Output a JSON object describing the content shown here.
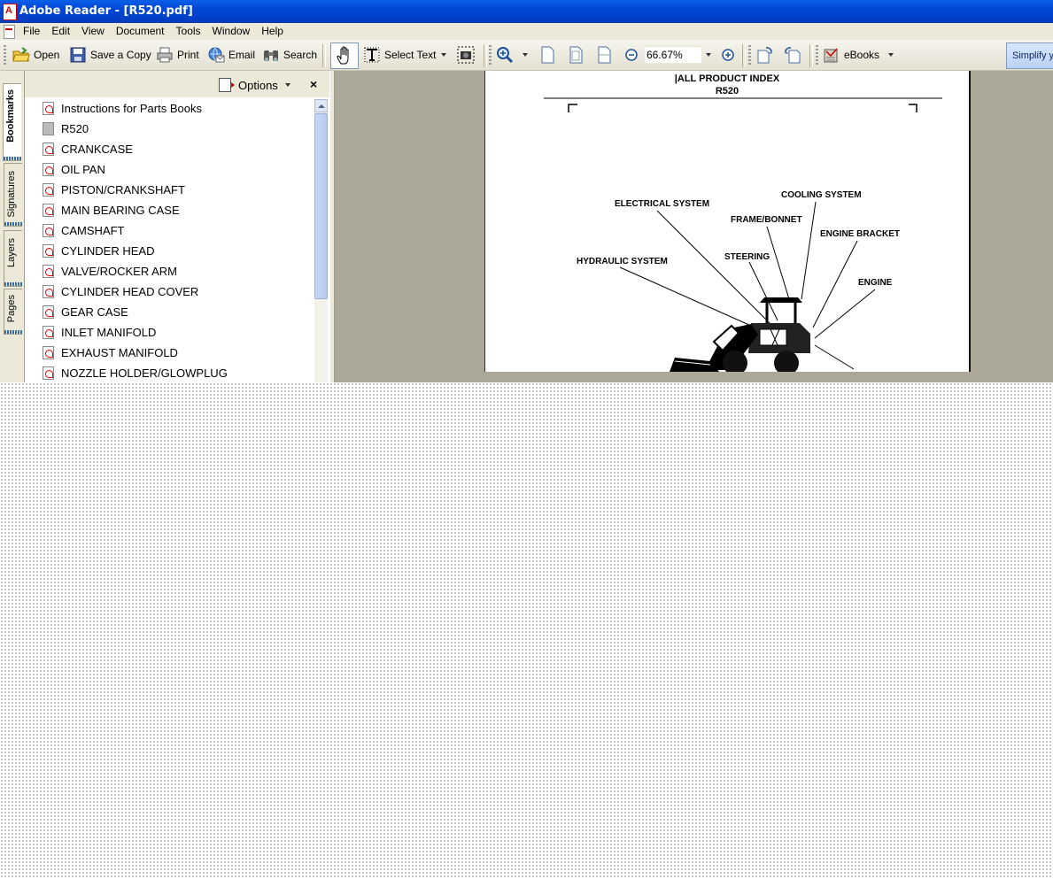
{
  "window": {
    "title": "Adobe Reader - [R520.pdf]"
  },
  "menu": [
    "File",
    "Edit",
    "View",
    "Document",
    "Tools",
    "Window",
    "Help"
  ],
  "toolbar": {
    "open": "Open",
    "save_copy": "Save a Copy",
    "print": "Print",
    "email": "Email",
    "search": "Search",
    "select_text": "Select Text",
    "zoom_value": "66.67%",
    "ebooks": "eBooks",
    "simplify": "Simplify y"
  },
  "nav_tabs": [
    "Bookmarks",
    "Signatures",
    "Layers",
    "Pages"
  ],
  "panel": {
    "options": "Options",
    "close": "×"
  },
  "bookmarks": [
    {
      "label": "Instructions for Parts Books",
      "icon": "pdf-page-icon"
    },
    {
      "label": "R520",
      "icon": "gray-page-icon"
    },
    {
      "label": "CRANKCASE",
      "icon": "pdf-page-icon"
    },
    {
      "label": "OIL PAN",
      "icon": "pdf-page-icon"
    },
    {
      "label": "PISTON/CRANKSHAFT",
      "icon": "pdf-page-icon"
    },
    {
      "label": "MAIN BEARING CASE",
      "icon": "pdf-page-icon"
    },
    {
      "label": "CAMSHAFT",
      "icon": "pdf-page-icon"
    },
    {
      "label": "CYLINDER HEAD",
      "icon": "pdf-page-icon"
    },
    {
      "label": "VALVE/ROCKER ARM",
      "icon": "pdf-page-icon"
    },
    {
      "label": "CYLINDER HEAD COVER",
      "icon": "pdf-page-icon"
    },
    {
      "label": "GEAR CASE",
      "icon": "pdf-page-icon"
    },
    {
      "label": "INLET MANIFOLD",
      "icon": "pdf-page-icon"
    },
    {
      "label": "EXHAUST MANIFOLD",
      "icon": "pdf-page-icon"
    },
    {
      "label": "NOZZLE HOLDER/GLOWPLUG",
      "icon": "pdf-page-icon"
    }
  ],
  "document": {
    "heading": "|ALL PRODUCT INDEX",
    "model": "R520",
    "labels": {
      "electrical": "ELECTRICAL SYSTEM",
      "cooling": "COOLING SYSTEM",
      "frame": "FRAME/BONNET",
      "engine_bracket": "ENGINE BRACKET",
      "hydraulic": "HYDRAULIC SYSTEM",
      "steering": "STEERING",
      "engine": "ENGINE"
    }
  }
}
